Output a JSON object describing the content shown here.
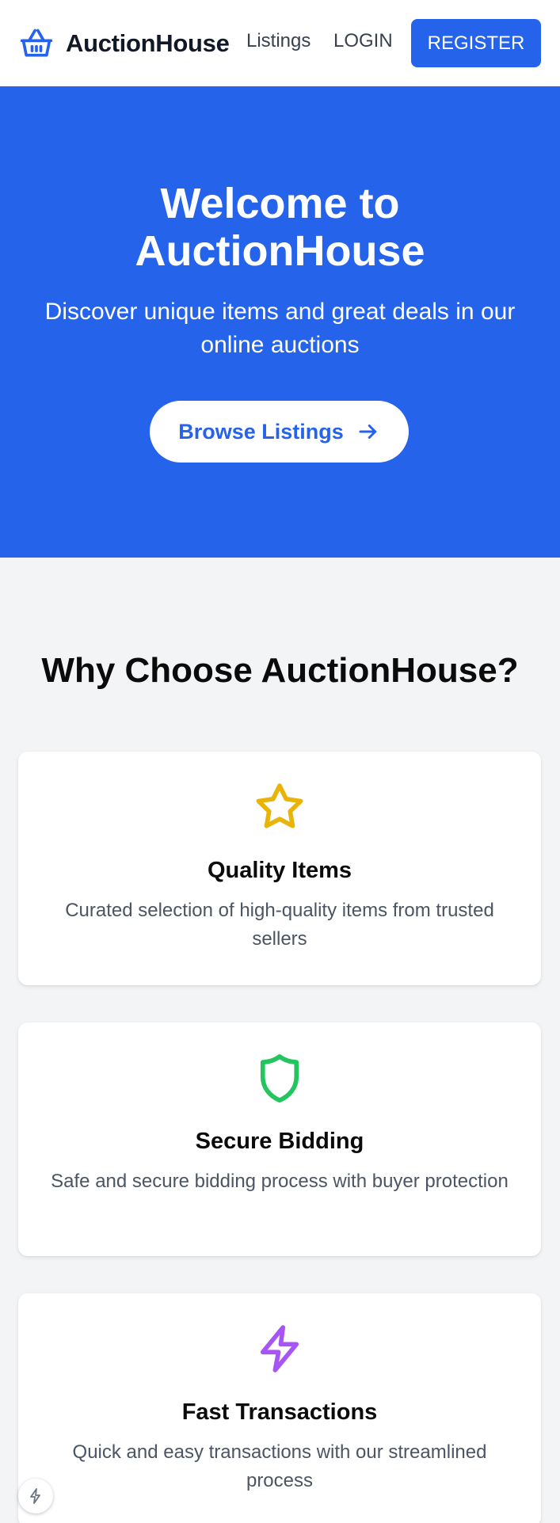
{
  "header": {
    "brand": "AuctionHouse",
    "nav": {
      "listings": "Listings",
      "login": "LOGIN",
      "register": "REGISTER"
    }
  },
  "hero": {
    "title_line1": "Welcome to",
    "title_line2": "AuctionHouse",
    "subtitle": "Discover unique items and great deals in our online auctions",
    "cta": "Browse Listings"
  },
  "features": {
    "heading": "Why Choose AuctionHouse?",
    "cards": [
      {
        "title": "Quality Items",
        "description": "Curated selection of high-quality items from trusted sellers",
        "icon": "star-icon",
        "color": "#eab308"
      },
      {
        "title": "Secure Bidding",
        "description": "Safe and secure bidding process with buyer protection",
        "icon": "shield-icon",
        "color": "#22c55e"
      },
      {
        "title": "Fast Transactions",
        "description": "Quick and easy transactions with our streamlined process",
        "icon": "lightning-icon",
        "color": "#a855f7"
      }
    ]
  },
  "colors": {
    "primary": "#2563eb",
    "background": "#f3f4f6"
  }
}
